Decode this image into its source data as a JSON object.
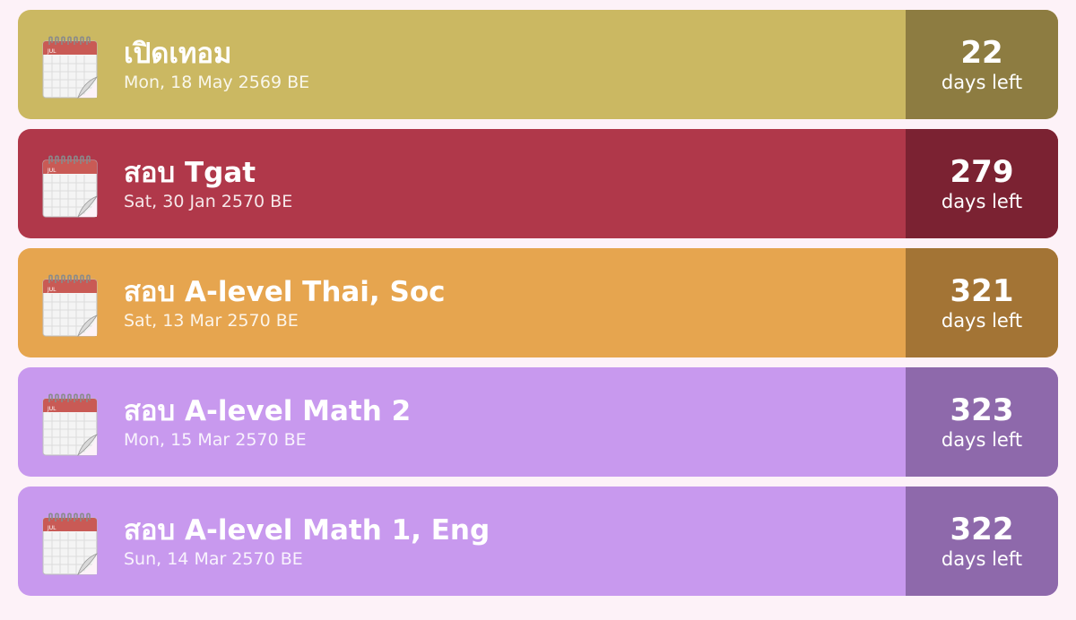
{
  "days_suffix": "days left",
  "events": [
    {
      "title": "เปิดเทอม",
      "date": "Mon, 18 May 2569 BE",
      "days": "22",
      "color": "#cbb862",
      "count_color": "#8d7c41"
    },
    {
      "title": "สอบ Tgat",
      "date": "Sat, 30 Jan 2570 BE",
      "days": "279",
      "color": "#b0384a",
      "count_color": "#7b2232"
    },
    {
      "title": "สอบ A-level Thai, Soc",
      "date": "Sat, 13 Mar 2570 BE",
      "days": "321",
      "color": "#e6a54f",
      "count_color": "#a37435"
    },
    {
      "title": "สอบ A-level Math 2",
      "date": "Mon, 15 Mar 2570 BE",
      "days": "323",
      "color": "#c899ee",
      "count_color": "#8e69ab"
    },
    {
      "title": "สอบ A-level Math 1, Eng",
      "date": "Sun, 14 Mar 2570 BE",
      "days": "322",
      "color": "#c899ee",
      "count_color": "#8e69ab"
    }
  ]
}
